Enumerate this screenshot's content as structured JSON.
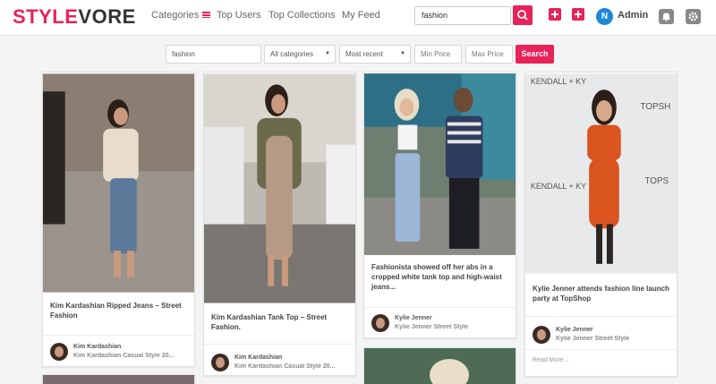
{
  "brand": {
    "part1": "STYLE",
    "part2": "VORE"
  },
  "nav": {
    "categories": "Categories",
    "top_users": "Top Users",
    "top_collections": "Top Collections",
    "my_feed": "My Feed"
  },
  "header_search": {
    "value": "fashion"
  },
  "user": {
    "initial": "N",
    "name": "Admin"
  },
  "filters": {
    "keyword": "fashion",
    "category": "All categories",
    "sort": "Most recent",
    "min_price_placeholder": "Min Price",
    "max_price_placeholder": "Max Price",
    "search_label": "Search"
  },
  "cards": [
    {
      "title": "Kim Kardashian Ripped Jeans – Street Fashion",
      "author": "Kim Kardashian",
      "collection": "Kim Kardashian Casual Style 20..."
    },
    {
      "title": "Kim Kardashian Tank Top – Street Fashion.",
      "author": "Kim Kardashian",
      "collection": "Kim Kardashian Casual Style 20..."
    },
    {
      "title": "Fashionista showed off her abs in a cropped white tank top and high-waist jeans...",
      "author": "Kylie Jenner",
      "collection": "Kylie Jenner Street Style"
    },
    {
      "title": "Kylie Jenner attends fashion line launch party at TopShop",
      "author": "Kylie Jenner",
      "collection": "Kylie Jenner Street Style",
      "read_more": "Read More..."
    }
  ],
  "colors": {
    "accent": "#e8225a",
    "avatar_blue": "#1e88d8"
  },
  "icons": [
    "menu-icon",
    "search-icon",
    "plus-icon",
    "add-image-icon",
    "bell-icon",
    "gear-icon"
  ]
}
